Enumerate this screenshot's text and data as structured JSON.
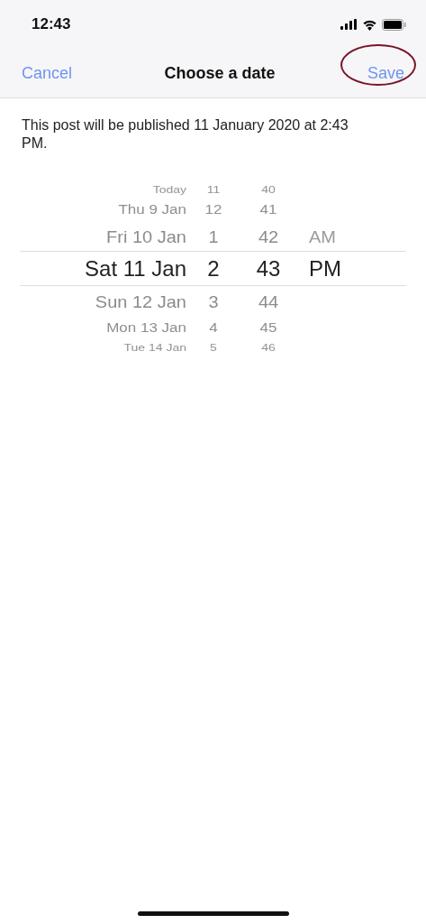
{
  "status_bar": {
    "time": "12:43"
  },
  "nav": {
    "cancel": "Cancel",
    "title": "Choose a date",
    "save": "Save",
    "save_circled": true
  },
  "message": "This post will be published 11 January 2020 at 2:43 PM.",
  "picker": {
    "rows": [
      {
        "day": "Today",
        "hour": "11",
        "minute": "40",
        "selected": false
      },
      {
        "day": "Thu 9 Jan",
        "hour": "12",
        "minute": "41",
        "selected": false
      },
      {
        "day": "Fri 10 Jan",
        "hour": "1",
        "minute": "42",
        "period": "AM",
        "selected": false
      },
      {
        "day": "Sat 11 Jan",
        "hour": "2",
        "minute": "43",
        "period": "PM",
        "selected": true
      },
      {
        "day": "Sun 12 Jan",
        "hour": "3",
        "minute": "44",
        "selected": false
      },
      {
        "day": "Mon 13 Jan",
        "hour": "4",
        "minute": "45",
        "selected": false
      },
      {
        "day": "Tue 14 Jan",
        "hour": "5",
        "minute": "46",
        "selected": false
      }
    ]
  }
}
